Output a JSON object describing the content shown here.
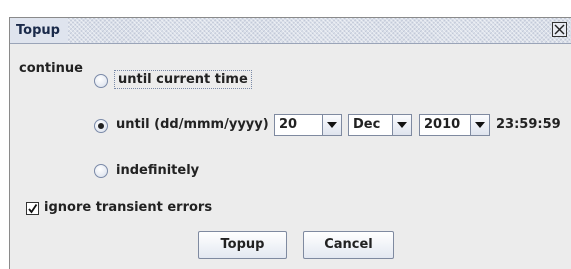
{
  "window": {
    "title": "Topup"
  },
  "form": {
    "continue_label": "continue",
    "options": [
      {
        "label": "until current time",
        "selected": false,
        "focused": true
      },
      {
        "label": "until (dd/mmm/yyyy)",
        "selected": true,
        "focused": false
      },
      {
        "label": "indefinitely",
        "selected": false,
        "focused": false
      }
    ],
    "date": {
      "day": "20",
      "month": "Dec",
      "year": "2010",
      "time": "23:59:59"
    },
    "ignore_errors": {
      "label": "ignore transient errors",
      "checked": true
    }
  },
  "buttons": {
    "topup": "Topup",
    "cancel": "Cancel"
  }
}
